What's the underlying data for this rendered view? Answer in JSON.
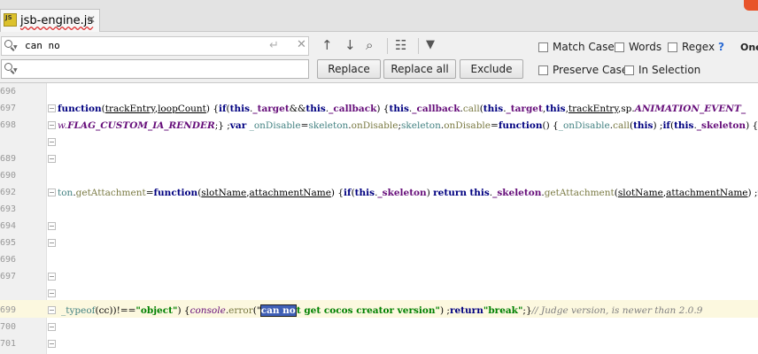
{
  "tab": {
    "icon_text": "JS",
    "label": "jsb-engine.js",
    "close_glyph": "✕"
  },
  "find": {
    "query": "can no",
    "history_icon": "search-history-icon",
    "enter_glyph": "↵",
    "clear_glyph": "✕"
  },
  "replace": {
    "value": "",
    "history_icon": "search-history-icon"
  },
  "toolbar": {
    "prev_glyph": "↑",
    "next_glyph": "↓",
    "find_all_glyph": "⌕",
    "select_all_glyph": "☷",
    "filter_glyph": "▼"
  },
  "options": {
    "match_case": "Match Case",
    "words": "Words",
    "regex": "Regex",
    "help": "?",
    "one_label": "One",
    "preserve_case": "Preserve Case",
    "in_selection": "In Selection"
  },
  "buttons": {
    "replace": "Replace",
    "replace_all": "Replace all",
    "exclude": "Exclude"
  },
  "line_numbers": [
    "696",
    "697",
    "698",
    "689",
    "690",
    "692",
    "693",
    "694",
    "695",
    "696",
    "697",
    "699",
    "700",
    "701"
  ],
  "code": {
    "l697": {
      "p1": "function",
      "p2": "(",
      "p3": "trackEntry",
      "p4": ",",
      "p5": "loopCount",
      "p6": ") {",
      "p7": "if",
      "p8": "(",
      "p9": "this",
      "p10": ".",
      "p11": "_target",
      "p12": "&&",
      "p13": "this",
      "p14": ".",
      "p15": "_callback",
      "p16": ") {",
      "p17": "this",
      "p18": ".",
      "p19": "_callback",
      "p20": ".",
      "p21": "call",
      "p22": "(",
      "p23": "this",
      "p24": ".",
      "p25": "_target",
      "p26": ",",
      "p27": "this",
      "p28": ",",
      "p29": "trackEntry",
      "p30": ",",
      "p31": "sp",
      "p32": ".",
      "p33": "ANIMATION_EVENT_"
    },
    "l698": {
      "p1": "w.",
      "p2": "FLAG_CUSTOM_IA_RENDER",
      "p3": ";} ;",
      "p4": "var",
      "p5": " ",
      "p6": "_onDisable",
      "p7": "=",
      "p8": "skeleton",
      "p9": ".",
      "p10": "onDisable",
      "p11": ";",
      "p12": "skeleton",
      "p13": ".",
      "p14": "onDisable",
      "p15": "=",
      "p16": "function",
      "p17": "() {",
      "p18": "_onDisable",
      "p19": ".",
      "p20": "call",
      "p21": "(",
      "p22": "this",
      "p23": ") ;",
      "p24": "if",
      "p25": "(",
      "p26": "this",
      "p27": ".",
      "p28": "_skeleton",
      "p29": ") {t"
    },
    "l692": {
      "p1": "ton",
      "p2": ".",
      "p3": "getAttachment",
      "p4": "=",
      "p5": "function",
      "p6": "(",
      "p7": "slotName",
      "p8": ",",
      "p9": "attachmentName",
      "p10": ") {",
      "p11": "if",
      "p12": "(",
      "p13": "this",
      "p14": ".",
      "p15": "_skeleton",
      "p16": ") ",
      "p17": "return",
      "p18": " ",
      "p19": "this",
      "p20": ".",
      "p21": "_skeleton",
      "p22": ".",
      "p23": "getAttachment",
      "p24": "(",
      "p25": "slotName",
      "p26": ",",
      "p27": "attachmentName",
      "p28": ") ;",
      "p29": "r"
    },
    "l699": {
      "p1": "_typeof",
      "p2": "(cc))!==",
      "p3": "\"object\"",
      "p4": ") {",
      "p5": "console",
      "p6": ".",
      "p7": "error",
      "p8": "(\"",
      "p9": "can no",
      "p10": "t get cocos creator version\"",
      "p11": ") ;",
      "p12": "return",
      "p13": "\"break\"",
      "p14": ";}",
      "p15": "// Judge version, is newer than 2.0.9"
    }
  }
}
